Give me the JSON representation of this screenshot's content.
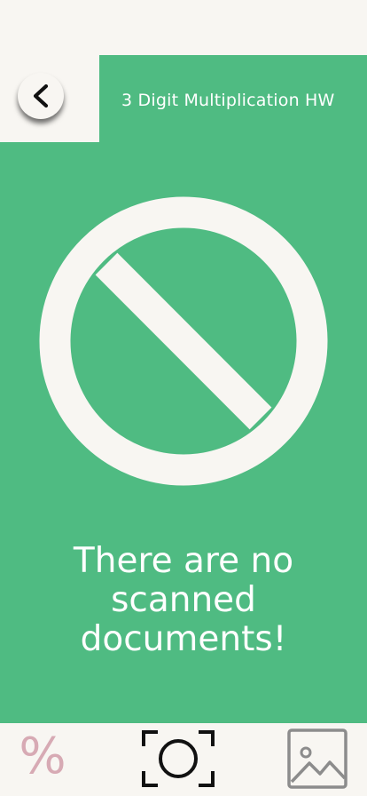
{
  "header": {
    "title": "3 Digit Multiplication HW",
    "back_icon": "chevron-left-icon"
  },
  "empty_state": {
    "icon": "no-entry-icon",
    "message": "There are no scanned documents!"
  },
  "bottom_nav": {
    "percent_label": "%",
    "camera_icon": "camera-scan-icon",
    "gallery_icon": "image-gallery-icon"
  },
  "colors": {
    "background": "#f8f6f2",
    "accent_green": "#4fbb82",
    "white": "#ffffff",
    "pink": "#d7aab4",
    "dark": "#111111",
    "gray": "#8c8c8c"
  }
}
